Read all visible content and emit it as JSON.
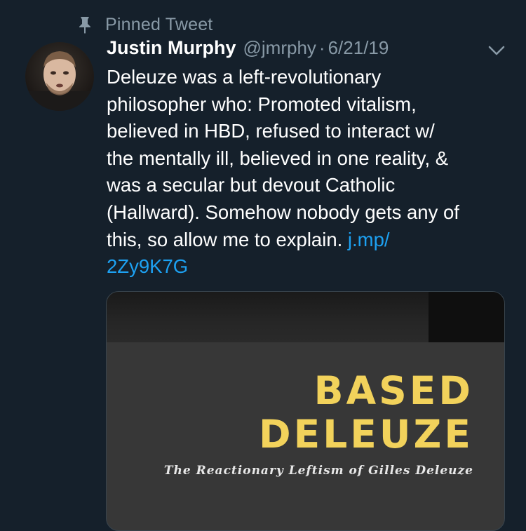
{
  "pinned": {
    "label": "Pinned Tweet",
    "icon": "pin-icon"
  },
  "author": {
    "name": "Justin Murphy",
    "handle": "@jmrphy",
    "separator": "·",
    "date": "6/21/19"
  },
  "tweet": {
    "text": "Deleuze was a left-revolutionary\nphilosopher who: Promoted vitalism,\nbelieved in HBD, refused to interact w/\nthe mentally ill, believed in one reality, &\nwas a secular but devout Catholic\n(Hallward). Somehow nobody gets any of\nthis, so allow me to explain. ",
    "link": "j.mp/\n2Zy9K7G"
  },
  "card": {
    "title": "BASED\nDELEUZE",
    "subtitle": "The Reactionary Leftism of Gilles Deleuze"
  },
  "colors": {
    "background": "#15202b",
    "secondary_text": "#8899a6",
    "link": "#1da1f2",
    "card_title": "#f2d25b",
    "card_border": "#38444d"
  }
}
